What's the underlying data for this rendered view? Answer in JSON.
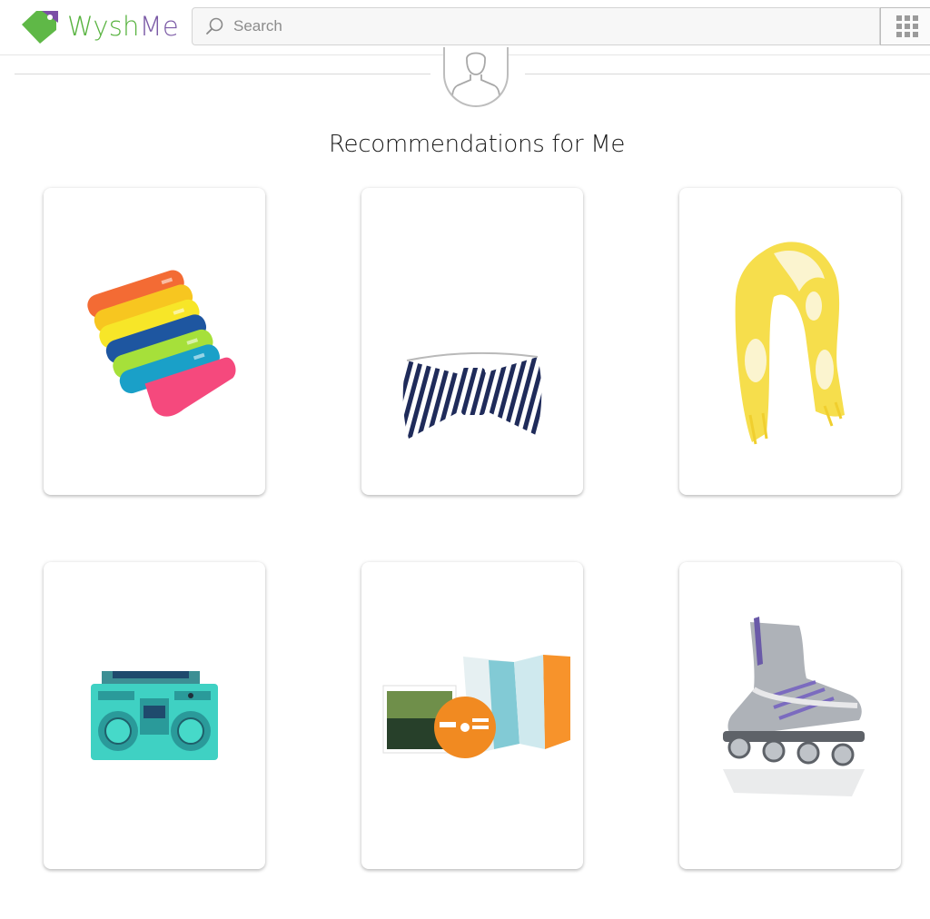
{
  "header": {
    "logo": {
      "text_part1": "Wysh",
      "text_part2": "Me",
      "icon": "price-tag-icon"
    },
    "search": {
      "placeholder": "Search",
      "value": ""
    },
    "apps_button_icon": "grid-icon"
  },
  "main": {
    "avatar_icon": "user-silhouette-icon",
    "title": "Recommendations for Me",
    "products": [
      {
        "name": "product-card-socks",
        "image": "colorful-socks-image"
      },
      {
        "name": "product-card-bow-clutch",
        "image": "striped-bow-clutch-image"
      },
      {
        "name": "product-card-scarf",
        "image": "yellow-scarf-image"
      },
      {
        "name": "product-card-boombox",
        "image": "boombox-image"
      },
      {
        "name": "product-card-road-to-hana",
        "image": "road-to-hana-dvd-image"
      },
      {
        "name": "product-card-inline-skate",
        "image": "inline-skate-image"
      }
    ]
  },
  "colors": {
    "logo_green": "#58b340",
    "logo_purple": "#7b5aa6",
    "divider": "#d8d8d8"
  }
}
